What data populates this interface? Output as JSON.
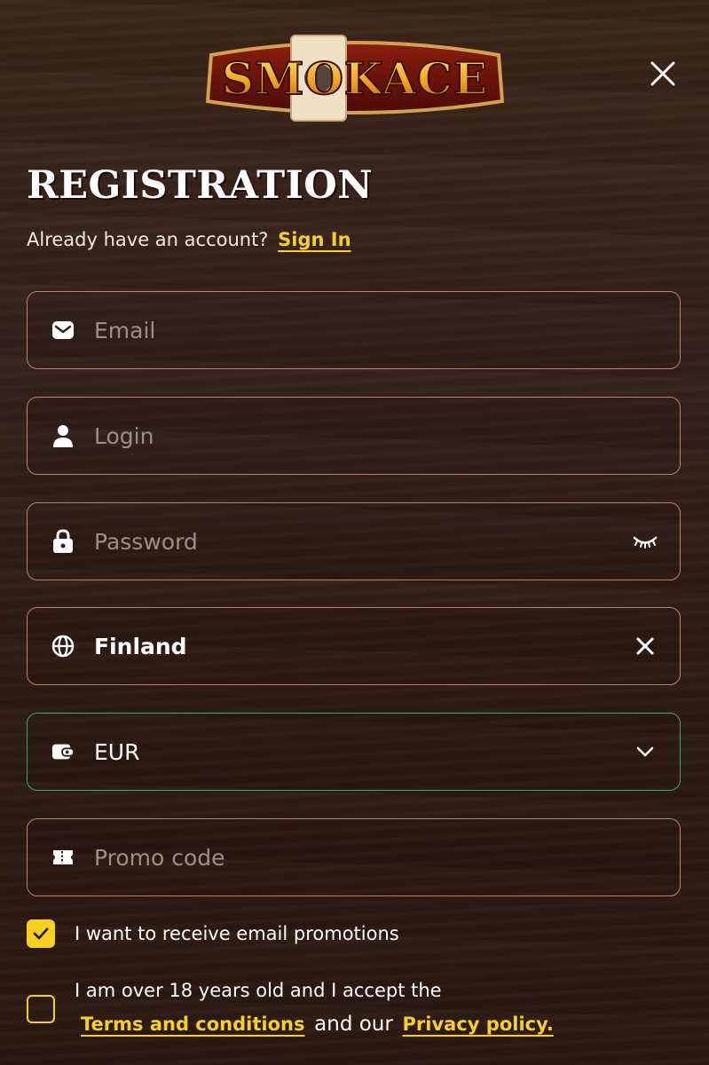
{
  "brand": {
    "logo_text": "SMOKACE"
  },
  "header": {
    "close_icon": "close-icon"
  },
  "form": {
    "title": "REGISTRATION",
    "signin_prompt": "Already have an account?",
    "signin_link": "Sign In",
    "email": {
      "placeholder": "Email",
      "icon": "envelope-icon"
    },
    "login": {
      "placeholder": "Login",
      "icon": "user-icon"
    },
    "password": {
      "placeholder": "Password",
      "icon": "lock-icon",
      "toggle_icon": "eye-closed-icon"
    },
    "country": {
      "value": "Finland",
      "icon": "globe-icon",
      "clear_icon": "clear-icon"
    },
    "currency": {
      "value": "EUR",
      "icon": "wallet-icon",
      "dropdown_icon": "chevron-down-icon"
    },
    "promo": {
      "placeholder": "Promo code",
      "icon": "ticket-icon"
    }
  },
  "consents": {
    "email_promotions": {
      "label": "I want to receive email promotions",
      "checked": true
    },
    "terms": {
      "checked": false,
      "text_before": "I am over 18 years old and I accept the",
      "terms_link": "Terms and conditions",
      "middle": "and our",
      "privacy_link": "Privacy policy."
    }
  },
  "colors": {
    "accent": "#f7d21d",
    "field_border": "#b9856c",
    "active_border": "#3ba760",
    "background": "#33201a"
  }
}
